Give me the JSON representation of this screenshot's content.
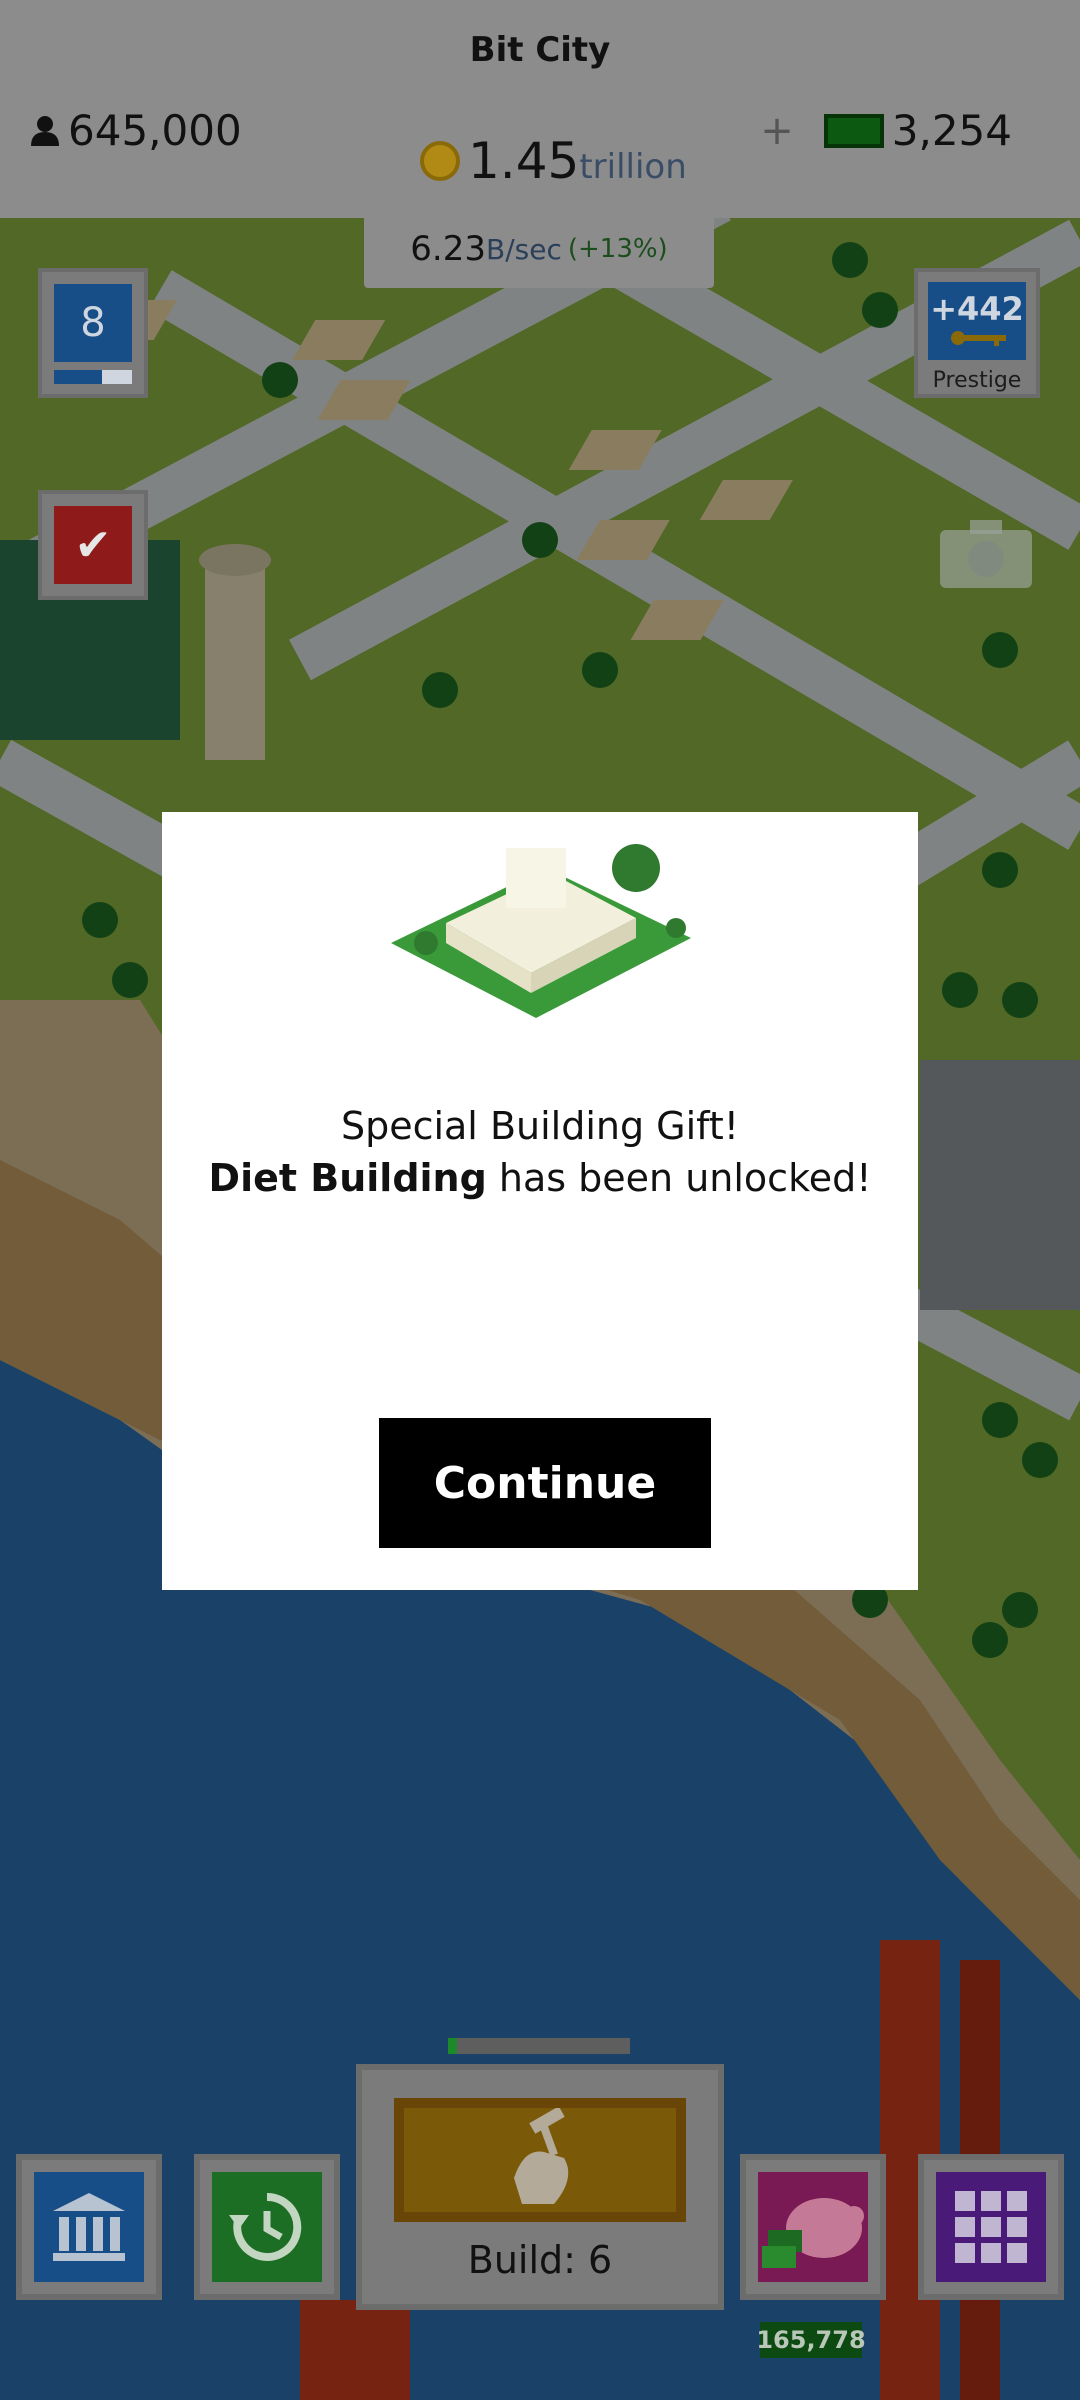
{
  "header": {
    "city_name": "Bit City",
    "population": "645,000",
    "coins_value": "1.45",
    "coins_unit": "trillion",
    "rate_value": "6.23",
    "rate_unit": "B/sec",
    "rate_percent": "(+13%)",
    "cash_plus": "+",
    "cash_value": "3,254"
  },
  "side": {
    "level": "8",
    "level_progress": 0.62,
    "task_icon": "checkmark-icon",
    "prestige_bonus": "+442",
    "prestige_label": "Prestige",
    "camera_icon": "camera-icon"
  },
  "dialog": {
    "line1": "Special Building Gift!",
    "building_name": "Diet Building",
    "line2_suffix": " has been unlocked!",
    "continue_label": "Continue",
    "image_icon": "building-image"
  },
  "bottom": {
    "build_label": "Build: 6",
    "build_progress": 0.05,
    "piggy_count": "165,778",
    "icons": [
      "bank-icon",
      "history-icon",
      "piggy-bank-icon",
      "grid-icon"
    ]
  },
  "colors": {
    "overlay": "rgba(0,0,0,0.38)",
    "dialog_bg": "#ffffff",
    "button_bg": "#000000"
  }
}
